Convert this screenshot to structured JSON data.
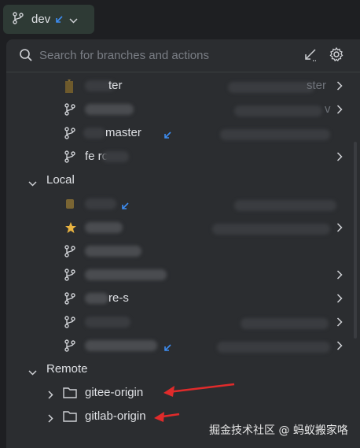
{
  "toolbar": {
    "branch_label": "dev"
  },
  "search": {
    "placeholder": "Search for branches and actions"
  },
  "recent_items": [
    {
      "label": "ter",
      "detail": "ster"
    },
    {
      "label": "",
      "detail": "v"
    },
    {
      "label": "master",
      "detail": ""
    },
    {
      "label": "fe rc",
      "detail": ""
    }
  ],
  "local": {
    "label": "Local",
    "items": [
      {
        "label": ""
      },
      {
        "label": ""
      },
      {
        "label": ""
      },
      {
        "label": ""
      },
      {
        "label": "re-s"
      },
      {
        "label": ""
      },
      {
        "label": ""
      }
    ]
  },
  "remote": {
    "label": "Remote",
    "items": [
      {
        "label": "gitee-origin"
      },
      {
        "label": "gitlab-origin"
      }
    ]
  },
  "watermark": "掘金技术社区 @ 蚂蚁搬家咯",
  "colors": {
    "accent_arrow": "#3d8cf0",
    "annotation": "#e02b2b",
    "star": "#e8b341"
  }
}
